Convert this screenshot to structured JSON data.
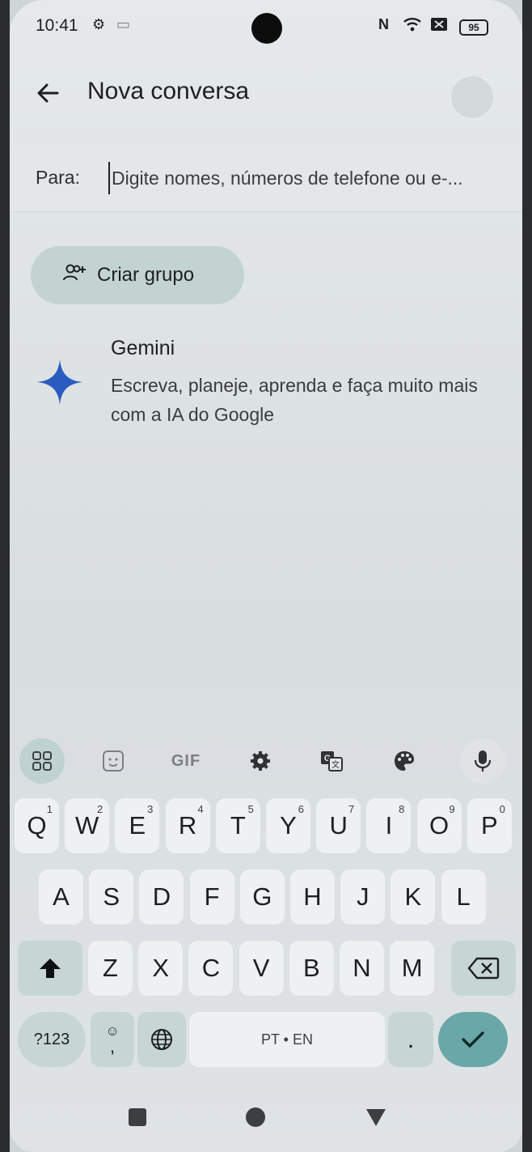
{
  "status_bar": {
    "time": "10:41",
    "battery": "95"
  },
  "app_bar": {
    "title": "Nova conversa"
  },
  "recipient": {
    "label": "Para:",
    "placeholder": "Digite nomes, números de telefone ou e-..."
  },
  "create_group": {
    "label": "Criar grupo"
  },
  "gemini": {
    "title": "Gemini",
    "description": "Escreva, planeje, aprenda e faça muito mais com a IA do Google"
  },
  "keyboard_toolbar": {
    "gif_label": "GIF"
  },
  "keyboard": {
    "row1": [
      {
        "k": "Q",
        "n": "1"
      },
      {
        "k": "W",
        "n": "2"
      },
      {
        "k": "E",
        "n": "3"
      },
      {
        "k": "R",
        "n": "4"
      },
      {
        "k": "T",
        "n": "5"
      },
      {
        "k": "Y",
        "n": "6"
      },
      {
        "k": "U",
        "n": "7"
      },
      {
        "k": "I",
        "n": "8"
      },
      {
        "k": "O",
        "n": "9"
      },
      {
        "k": "P",
        "n": "0"
      }
    ],
    "row2": [
      "A",
      "S",
      "D",
      "F",
      "G",
      "H",
      "J",
      "K",
      "L"
    ],
    "row3": [
      "Z",
      "X",
      "C",
      "V",
      "B",
      "N",
      "M"
    ],
    "symbols_label": "?123",
    "emoji_sub": ",",
    "space_label": "PT • EN",
    "period": "."
  },
  "colors": {
    "accent": "#6aa7a8",
    "chip": "#c3d3d2",
    "gemini_star": "#2a5bbf"
  }
}
